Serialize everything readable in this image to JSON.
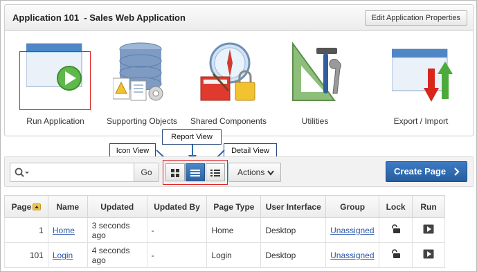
{
  "app": {
    "title": "Application 101  - Sales Web Application",
    "edit_button": "Edit Application Properties"
  },
  "tiles": [
    {
      "label": "Run Application",
      "icon": "run-application-icon"
    },
    {
      "label": "Supporting Objects",
      "icon": "supporting-objects-icon"
    },
    {
      "label": "Shared Components",
      "icon": "shared-components-icon"
    },
    {
      "label": "Utilities",
      "icon": "utilities-icon"
    },
    {
      "label": "Export / Import",
      "icon": "export-import-icon"
    }
  ],
  "callouts": {
    "icon_view": "Icon View",
    "report_view": "Report View",
    "detail_view": "Detail View"
  },
  "toolbar": {
    "search_placeholder": "",
    "go_label": "Go",
    "actions_label": "Actions",
    "create_label": "Create Page"
  },
  "table": {
    "headers": [
      "Page",
      "Name",
      "Updated",
      "Updated By",
      "Page Type",
      "User Interface",
      "Group",
      "Lock",
      "Run"
    ],
    "rows": [
      {
        "page": "1",
        "name": "Home",
        "updated": "3 seconds ago",
        "updated_by": "-",
        "page_type": "Home",
        "ui": "Desktop",
        "group": "Unassigned"
      },
      {
        "page": "101",
        "name": "Login",
        "updated": "4 seconds ago",
        "updated_by": "-",
        "page_type": "Login",
        "ui": "Desktop",
        "group": "Unassigned"
      }
    ]
  },
  "colors": {
    "primary_button": "#2f6aae",
    "highlight_box": "#e02020",
    "link": "#2a56a8"
  }
}
